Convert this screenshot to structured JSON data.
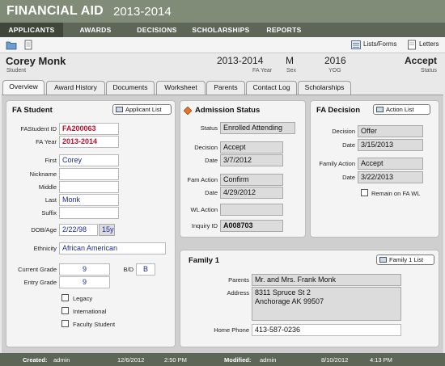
{
  "app": {
    "title": "FINANCIAL AID",
    "year": "2013-2014"
  },
  "nav": [
    "APPLICANTS",
    "AWARDS",
    "DECISIONS",
    "SCHOLARSHIPS",
    "REPORTS"
  ],
  "toolbar": {
    "lists_forms": "Lists/Forms",
    "letters": "Letters"
  },
  "header": {
    "name": "Corey Monk",
    "name_sub": "Student",
    "year": "2013-2014",
    "year_sub": "FA Year",
    "sex": "M",
    "sex_sub": "Sex",
    "yog": "2016",
    "yog_sub": "YOG",
    "status": "Accept",
    "status_sub": "Status"
  },
  "tabs": [
    "Overview",
    "Award History",
    "Documents",
    "Worksheet",
    "Parents",
    "Contact Log",
    "Scholarships"
  ],
  "fa_student": {
    "title": "FA Student",
    "button": "Applicant List",
    "labels": {
      "fastudent_id": "FAStudent ID",
      "fa_year": "FA Year",
      "first": "First",
      "nickname": "Nickname",
      "middle": "Middle",
      "last": "Last",
      "suffix": "Suffix",
      "dob_age": "DOB/Age",
      "ethnicity": "Ethnicity",
      "current_grade": "Current Grade",
      "bd": "B/D",
      "entry_grade": "Entry Grade"
    },
    "values": {
      "fastudent_id": "FA200063",
      "fa_year": "2013-2014",
      "first": "Corey",
      "nickname": "",
      "middle": "",
      "last": "Monk",
      "suffix": "",
      "dob": "2/22/98",
      "age": "15y",
      "ethnicity": "African American",
      "current_grade": "9",
      "bd": "B",
      "entry_grade": "9"
    },
    "checkboxes": [
      "Legacy",
      "International",
      "Faculty Student"
    ]
  },
  "admission": {
    "title": "Admission Status",
    "labels": {
      "status": "Status",
      "decision": "Decision",
      "date": "Date",
      "fam_action": "Fam Action",
      "date2": "Date",
      "wl_action": "WL Action",
      "inquiry_id": "Inquiry ID"
    },
    "values": {
      "status": "Enrolled Attending",
      "decision": "Accept",
      "date": "3/7/2012",
      "fam_action": "Confirm",
      "date2": "4/29/2012",
      "wl_action": "",
      "inquiry_id": "A008703"
    }
  },
  "fa_decision": {
    "title": "FA Decision",
    "button": "Action List",
    "labels": {
      "decision": "Decision",
      "date": "Date",
      "family_action": "Family Action",
      "date2": "Date"
    },
    "values": {
      "decision": "Offer",
      "date": "3/15/2013",
      "family_action": "Accept",
      "date2": "3/22/2013"
    },
    "checkbox": "Remain on FA WL"
  },
  "family": {
    "title": "Family 1",
    "button": "Family 1 List",
    "labels": {
      "parents": "Parents",
      "address": "Address",
      "home_phone": "Home Phone"
    },
    "values": {
      "parents": "Mr. and Mrs. Frank Monk",
      "address": "8311 Spruce St 2\nAnchorage AK 99507",
      "home_phone": "413-587-0236"
    }
  },
  "footer": {
    "created_label": "Created:",
    "created_by": "admin",
    "created_date": "12/6/2012",
    "created_time": "2:50 PM",
    "modified_label": "Modified:",
    "modified_by": "admin",
    "modified_date": "8/10/2012",
    "modified_time": "4:13 PM"
  },
  "colors": {
    "title_bar": "#808b78",
    "nav_bar": "#5d6657",
    "active_nav": "#3f463a",
    "red_value": "#c0102a",
    "blue_value": "#1a2b9c"
  }
}
